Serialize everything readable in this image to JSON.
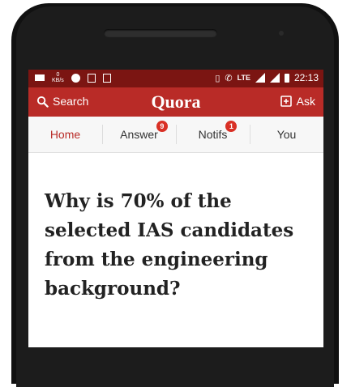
{
  "status_bar": {
    "net_speed_value": "0",
    "net_speed_unit": "KB/s",
    "network_type": "LTE",
    "time": "22:13"
  },
  "app_bar": {
    "search_label": "Search",
    "logo": "Quora",
    "ask_label": "Ask"
  },
  "tabs": [
    {
      "label": "Home",
      "active": true
    },
    {
      "label": "Answer",
      "badge": "9"
    },
    {
      "label": "Notifs",
      "badge": "1"
    },
    {
      "label": "You"
    }
  ],
  "question": {
    "text": "Why is 70% of the selected IAS candidates from the engineering background?"
  },
  "colors": {
    "status_bar": "#7b1512",
    "brand": "#b92b27",
    "badge": "#d93025"
  }
}
